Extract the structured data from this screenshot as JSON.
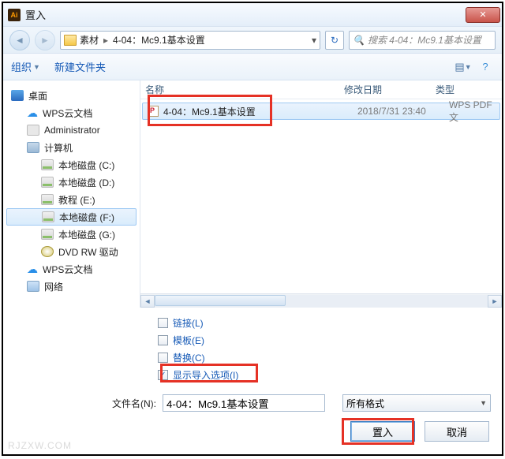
{
  "window": {
    "title": "置入"
  },
  "nav": {
    "crumbs": [
      "素材",
      "4-04：Mc9.1基本设置"
    ],
    "search_placeholder": "搜索 4-04：Mc9.1基本设置"
  },
  "toolbar": {
    "organize": "组织",
    "new_folder": "新建文件夹"
  },
  "tree": {
    "desktop": "桌面",
    "wps1": "WPS云文档",
    "admin": "Administrator",
    "computer": "计算机",
    "drive_c": "本地磁盘 (C:)",
    "drive_d": "本地磁盘 (D:)",
    "drive_e": "教程 (E:)",
    "drive_f": "本地磁盘 (F:)",
    "drive_g": "本地磁盘 (G:)",
    "dvd": "DVD RW 驱动",
    "wps2": "WPS云文档",
    "network": "网络"
  },
  "list": {
    "col_name": "名称",
    "col_date": "修改日期",
    "col_type": "类型",
    "rows": [
      {
        "name": "4-04：Mc9.1基本设置",
        "date": "2018/7/31 23:40",
        "type": "WPS PDF 文"
      }
    ]
  },
  "options": {
    "link": "链接(L)",
    "template": "模板(E)",
    "replace": "替换(C)",
    "show_import": "显示导入选项(I)",
    "show_import_checked": "✓"
  },
  "filename": {
    "label": "文件名(N):",
    "value": "4-04：Mc9.1基本设置",
    "format": "所有格式"
  },
  "buttons": {
    "place": "置入",
    "cancel": "取消"
  },
  "watermark": "RJZXW.COM"
}
